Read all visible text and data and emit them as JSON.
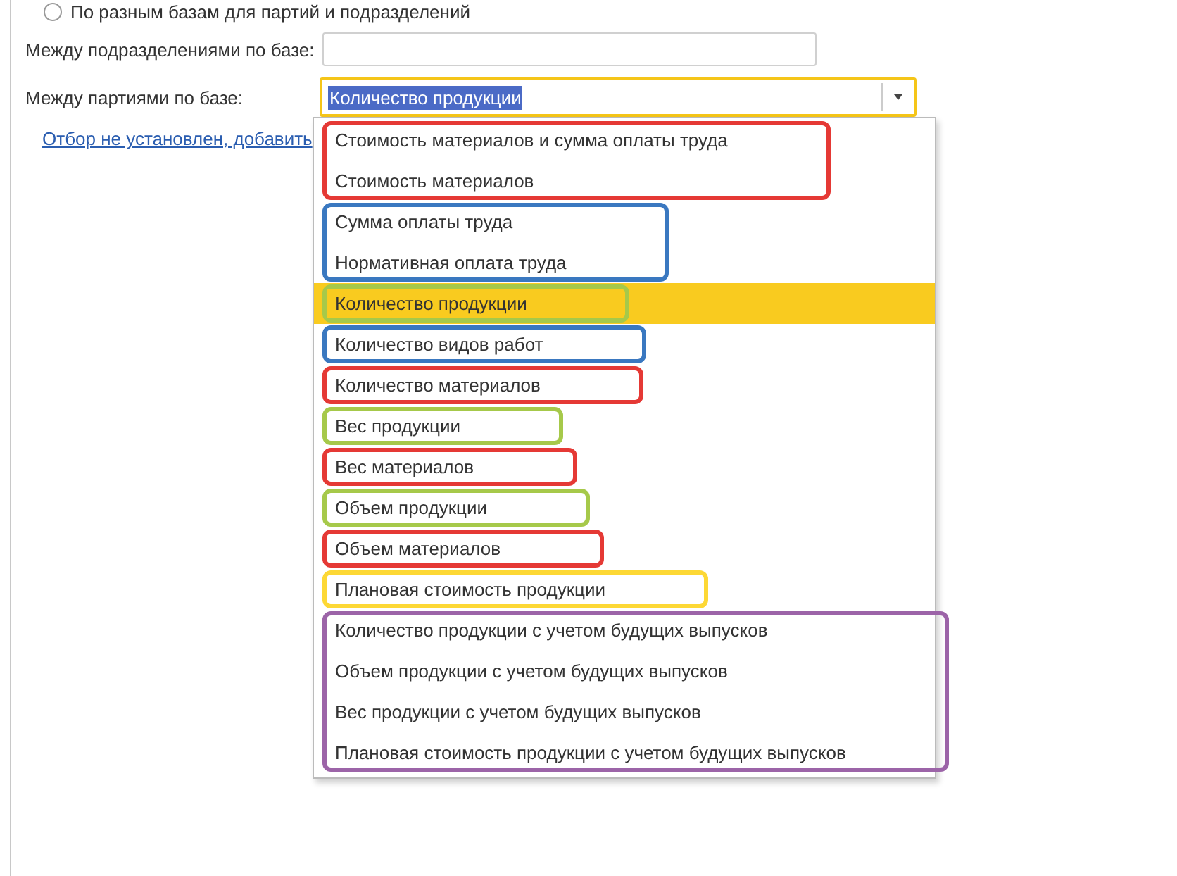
{
  "radio": {
    "label": "По разным базам для партий и подразделений",
    "selected": false
  },
  "fields": [
    {
      "label": "Между подразделениями по базе:"
    },
    {
      "label": "Между партиями по базе:",
      "value": "Количество продукции"
    }
  ],
  "filter_link": "Отбор не установлен, добавить",
  "dropdown": {
    "groups": [
      {
        "color": "#e53935",
        "items": [
          {
            "label": "Стоимость материалов и сумма оплаты труда",
            "selected": false
          },
          {
            "label": "Стоимость материалов",
            "selected": false
          }
        ]
      },
      {
        "color": "#3a78c0",
        "items": [
          {
            "label": "Сумма оплаты труда",
            "selected": false
          },
          {
            "label": "Нормативная оплата труда",
            "selected": false
          }
        ]
      },
      {
        "color": "#a6c94a",
        "items": [
          {
            "label": "Количество продукции",
            "selected": true
          }
        ]
      },
      {
        "color": "#3a78c0",
        "items": [
          {
            "label": "Количество видов работ",
            "selected": false
          }
        ]
      },
      {
        "color": "#e53935",
        "items": [
          {
            "label": "Количество материалов",
            "selected": false
          }
        ]
      },
      {
        "color": "#a6c94a",
        "items": [
          {
            "label": "Вес продукции",
            "selected": false
          }
        ]
      },
      {
        "color": "#e53935",
        "items": [
          {
            "label": "Вес материалов",
            "selected": false
          }
        ]
      },
      {
        "color": "#a6c94a",
        "items": [
          {
            "label": "Объем продукции",
            "selected": false
          }
        ]
      },
      {
        "color": "#e53935",
        "items": [
          {
            "label": "Объем материалов",
            "selected": false
          }
        ]
      },
      {
        "color": "#fdd835",
        "items": [
          {
            "label": "Плановая стоимость продукции",
            "selected": false
          }
        ]
      },
      {
        "color": "#9c64a8",
        "items": [
          {
            "label": "Количество продукции с учетом будущих выпусков",
            "selected": false
          },
          {
            "label": "Объем продукции с учетом будущих выпусков",
            "selected": false
          },
          {
            "label": "Вес продукции с учетом будущих выпусков",
            "selected": false
          },
          {
            "label": "Плановая стоимость продукции с учетом будущих выпусков",
            "selected": false
          }
        ]
      }
    ]
  }
}
